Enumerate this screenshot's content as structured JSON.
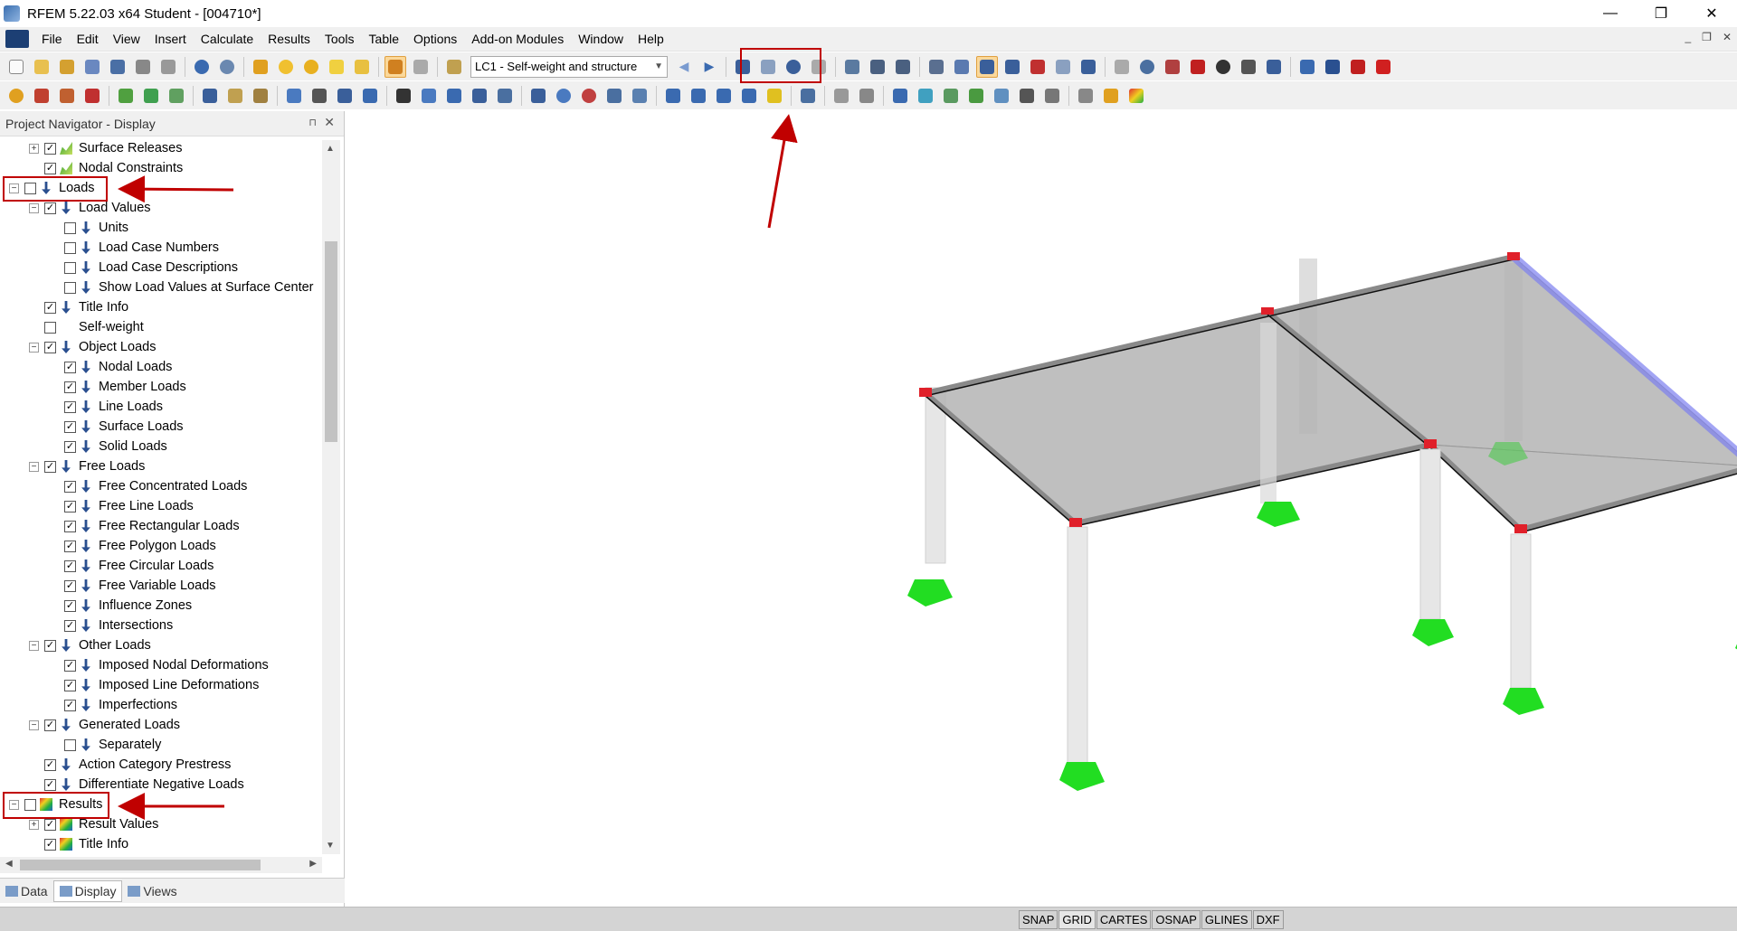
{
  "window": {
    "title": "RFEM 5.22.03 x64 Student - [004710*]",
    "controls": [
      "—",
      "❐",
      "✕"
    ]
  },
  "menu": {
    "items": [
      "File",
      "Edit",
      "View",
      "Insert",
      "Calculate",
      "Results",
      "Tools",
      "Table",
      "Options",
      "Add-on Modules",
      "Window",
      "Help"
    ],
    "mdi_controls": [
      "_",
      "❐",
      "✕"
    ]
  },
  "toolbar": {
    "load_case_selector": "LC1 - Self-weight and structure"
  },
  "navigator": {
    "title": "Project Navigator - Display",
    "tabs": [
      "Data",
      "Display",
      "Views"
    ],
    "tree": [
      {
        "label": "Surface Releases",
        "checked": true,
        "icon": "green",
        "expander": "+"
      },
      {
        "label": "Nodal Constraints",
        "checked": true,
        "icon": "green",
        "expander": ""
      },
      {
        "label": "Loads",
        "checked": false,
        "icon": "load",
        "expander": "−"
      },
      {
        "label": "Load Values",
        "checked": true,
        "icon": "load",
        "expander": "−"
      },
      {
        "label": "Units",
        "checked": false,
        "icon": "load",
        "expander": ""
      },
      {
        "label": "Load Case Numbers",
        "checked": false,
        "icon": "load",
        "expander": ""
      },
      {
        "label": "Load Case Descriptions",
        "checked": false,
        "icon": "load",
        "expander": ""
      },
      {
        "label": "Show Load Values at Surface Center",
        "checked": false,
        "icon": "load",
        "expander": ""
      },
      {
        "label": "Title Info",
        "checked": true,
        "icon": "load",
        "expander": ""
      },
      {
        "label": "Self-weight",
        "checked": false,
        "icon": "none",
        "expander": ""
      },
      {
        "label": "Object Loads",
        "checked": true,
        "icon": "load",
        "expander": "−"
      },
      {
        "label": "Nodal Loads",
        "checked": true,
        "icon": "load",
        "expander": ""
      },
      {
        "label": "Member Loads",
        "checked": true,
        "icon": "load",
        "expander": ""
      },
      {
        "label": "Line Loads",
        "checked": true,
        "icon": "load",
        "expander": ""
      },
      {
        "label": "Surface Loads",
        "checked": true,
        "icon": "load",
        "expander": ""
      },
      {
        "label": "Solid Loads",
        "checked": true,
        "icon": "load",
        "expander": ""
      },
      {
        "label": "Free Loads",
        "checked": true,
        "icon": "load",
        "expander": "−"
      },
      {
        "label": "Free Concentrated Loads",
        "checked": true,
        "icon": "load",
        "expander": ""
      },
      {
        "label": "Free Line Loads",
        "checked": true,
        "icon": "load",
        "expander": ""
      },
      {
        "label": "Free Rectangular Loads",
        "checked": true,
        "icon": "load",
        "expander": ""
      },
      {
        "label": "Free Polygon Loads",
        "checked": true,
        "icon": "load",
        "expander": ""
      },
      {
        "label": "Free Circular Loads",
        "checked": true,
        "icon": "load",
        "expander": ""
      },
      {
        "label": "Free Variable Loads",
        "checked": true,
        "icon": "load",
        "expander": ""
      },
      {
        "label": "Influence Zones",
        "checked": true,
        "icon": "load",
        "expander": ""
      },
      {
        "label": "Intersections",
        "checked": true,
        "icon": "load",
        "expander": ""
      },
      {
        "label": "Other Loads",
        "checked": true,
        "icon": "load",
        "expander": "−"
      },
      {
        "label": "Imposed Nodal Deformations",
        "checked": true,
        "icon": "load",
        "expander": ""
      },
      {
        "label": "Imposed Line Deformations",
        "checked": true,
        "icon": "load",
        "expander": ""
      },
      {
        "label": "Imperfections",
        "checked": true,
        "icon": "load",
        "expander": ""
      },
      {
        "label": "Generated Loads",
        "checked": true,
        "icon": "load",
        "expander": "−"
      },
      {
        "label": "Separately",
        "checked": false,
        "icon": "load",
        "expander": ""
      },
      {
        "label": "Action Category Prestress",
        "checked": true,
        "icon": "load",
        "expander": ""
      },
      {
        "label": "Differentiate Negative Loads",
        "checked": true,
        "icon": "load",
        "expander": ""
      },
      {
        "label": "Results",
        "checked": false,
        "icon": "res",
        "expander": "−"
      },
      {
        "label": "Result Values",
        "checked": true,
        "icon": "res",
        "expander": "+"
      },
      {
        "label": "Title Info",
        "checked": true,
        "icon": "res",
        "expander": ""
      }
    ]
  },
  "status": {
    "buttons": [
      "SNAP",
      "GRID",
      "CARTES",
      "OSNAP",
      "GLINES",
      "DXF"
    ],
    "active": "GRID"
  },
  "colors": {
    "annotation_red": "#c00000",
    "support_green": "#22dd22",
    "node_red": "#e0202a",
    "slab_gray": "#b4b4b4"
  }
}
